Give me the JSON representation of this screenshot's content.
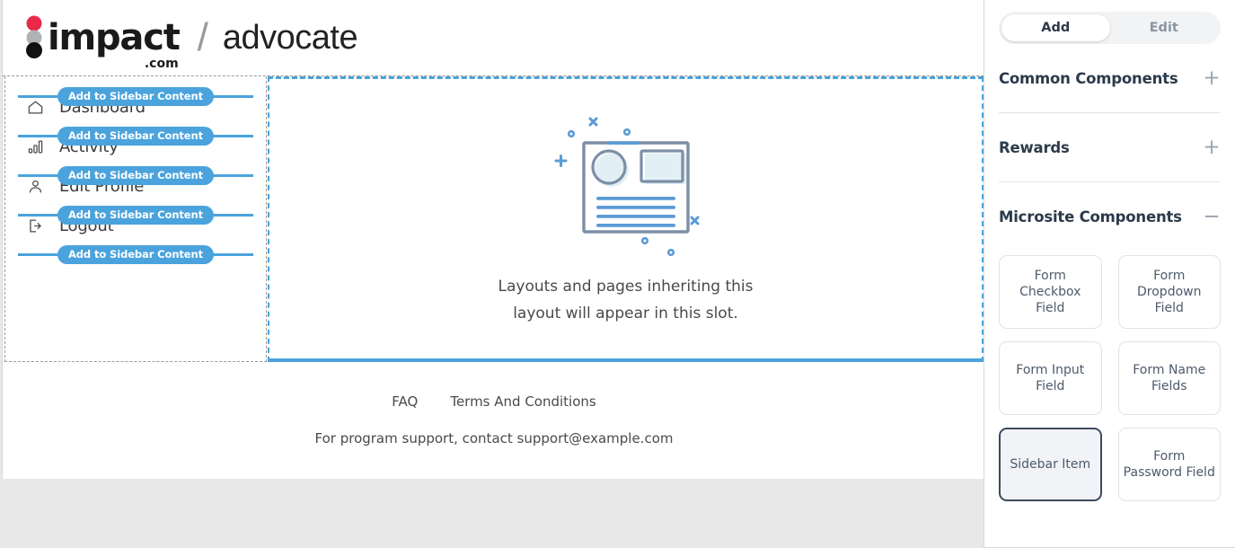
{
  "brand": {
    "name": "impact",
    "suffix": ".com",
    "divider": "/",
    "product": "advocate",
    "dot_colors": [
      "#e8294a",
      "#b0b3b5",
      "#111111"
    ]
  },
  "editor": {
    "add_bar_label": "Add to Sidebar Content",
    "sidebar_items": [
      {
        "label": "Dashboard",
        "icon": "home-icon"
      },
      {
        "label": "Activity",
        "icon": "bar-chart-icon"
      },
      {
        "label": "Edit Profile",
        "icon": "person-icon"
      },
      {
        "label": "Logout",
        "icon": "logout-icon"
      }
    ],
    "slot": {
      "line1": "Layouts and pages inheriting this",
      "line2": "layout will appear in this slot.",
      "illustration": "document-placeholder-illustration"
    },
    "footer": {
      "links": [
        "FAQ",
        "Terms And Conditions"
      ],
      "support_note": "For program support, contact support@example.com"
    }
  },
  "inspector": {
    "tabs": [
      {
        "label": "Add",
        "selected": true
      },
      {
        "label": "Edit",
        "selected": false
      }
    ],
    "sections": [
      {
        "title": "Common Components",
        "toggle": "+",
        "expanded": false
      },
      {
        "title": "Rewards",
        "toggle": "+",
        "expanded": false
      },
      {
        "title": "Microsite Components",
        "toggle": "−",
        "expanded": true
      }
    ],
    "components": [
      {
        "label": "Form Checkbox Field",
        "selected": false
      },
      {
        "label": "Form Dropdown Field",
        "selected": false
      },
      {
        "label": "Form Input Field",
        "selected": false
      },
      {
        "label": "Form Name Fields",
        "selected": false
      },
      {
        "label": "Sidebar Item",
        "selected": true
      },
      {
        "label": "Form Password Field",
        "selected": false
      }
    ]
  },
  "colors": {
    "accent_blue": "#4aa3dc",
    "panel_text": "#2c3a4b",
    "page_bg": "#e8e8e8"
  }
}
